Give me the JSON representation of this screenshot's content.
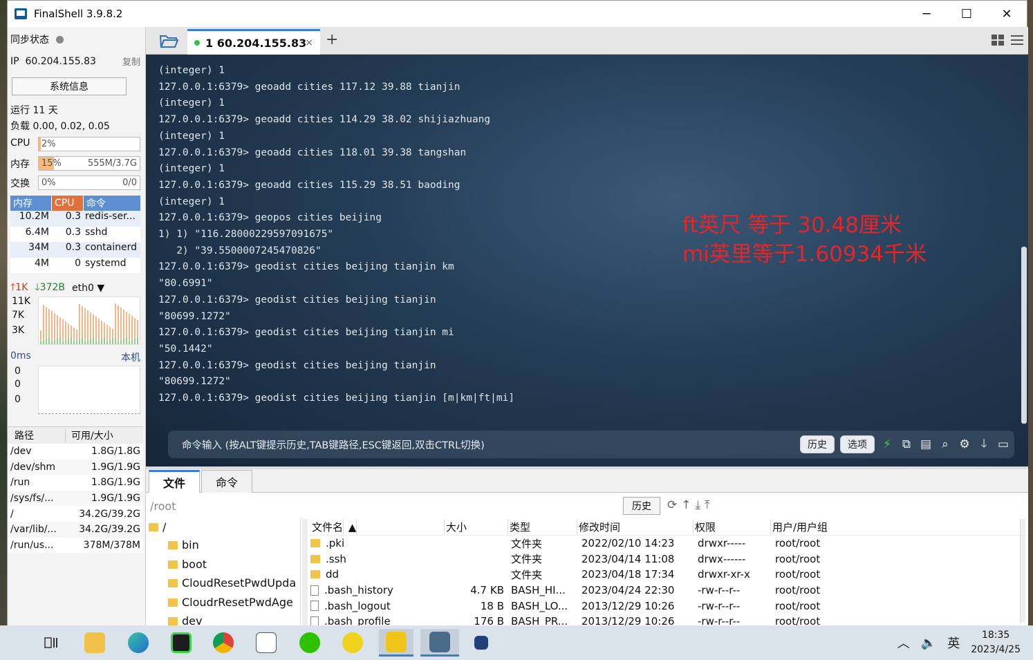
{
  "window": {
    "title": "FinalShell 3.9.8.2",
    "minimize": "─",
    "maximize": "☐",
    "close": "✕"
  },
  "left": {
    "sync_label": "同步状态",
    "ip_label": "IP",
    "ip_value": "60.204.155.83",
    "copy_label": "复制",
    "sysinfo_button": "系统信息",
    "uptime": "运行 11 天",
    "load": "负载 0.00, 0.02, 0.05",
    "cpu_label": "CPU",
    "cpu_value": "2%",
    "cpu_fraction": 0.02,
    "mem_label": "内存",
    "mem_value": "15%",
    "mem_fraction": 0.15,
    "mem_detail": "555M/3.7G",
    "swap_label": "交换",
    "swap_value": "0%",
    "swap_detail": "0/0",
    "proc_headers": [
      "内存",
      "CPU",
      "命令"
    ],
    "processes": [
      {
        "mem": "10.2M",
        "cpu": "0.3",
        "cmd": "redis-ser..."
      },
      {
        "mem": "6.4M",
        "cpu": "0.3",
        "cmd": "sshd"
      },
      {
        "mem": "34M",
        "cpu": "0.3",
        "cmd": "containerd"
      },
      {
        "mem": "4M",
        "cpu": "0",
        "cmd": "systemd"
      }
    ],
    "net_up": "1K",
    "net_down": "372B",
    "net_iface": "eth0",
    "net_axis": [
      "11K",
      "7K",
      "3K"
    ],
    "ping_ms": "0ms",
    "ping_target": "本机",
    "ping_axis": [
      "0",
      "0",
      "0"
    ],
    "disk_headers": [
      "路径",
      "可用/大小"
    ],
    "disks": [
      {
        "path": "/dev",
        "size": "1.8G/1.8G"
      },
      {
        "path": "/dev/shm",
        "size": "1.9G/1.9G"
      },
      {
        "path": "/run",
        "size": "1.8G/1.9G"
      },
      {
        "path": "/sys/fs/...",
        "size": "1.9G/1.9G"
      },
      {
        "path": "/",
        "size": "34.2G/39.2G"
      },
      {
        "path": "/var/lib/...",
        "size": "34.2G/39.2G"
      },
      {
        "path": "/run/us...",
        "size": "378M/378M"
      }
    ]
  },
  "tabs": {
    "session_label": "1 60.204.155.83",
    "close": "×",
    "add": "+"
  },
  "terminal": {
    "lines": [
      "(integer) 1",
      "127.0.0.1:6379> geoadd cities 117.12 39.88 tianjin",
      "(integer) 1",
      "127.0.0.1:6379> geoadd cities 114.29 38.02 shijiazhuang",
      "(integer) 1",
      "127.0.0.1:6379> geoadd cities 118.01 39.38 tangshan",
      "(integer) 1",
      "127.0.0.1:6379> geoadd cities 115.29 38.51 baoding",
      "(integer) 1",
      "127.0.0.1:6379> geopos cities beijing",
      "1) 1) \"116.28000229597091675\"",
      "   2) \"39.5500007245470826\"",
      "127.0.0.1:6379> geodist cities beijing tianjin km",
      "\"80.6991\"",
      "127.0.0.1:6379> geodist cities beijing tianjin",
      "\"80699.1272\"",
      "127.0.0.1:6379> geodist cities beijing tianjin mi",
      "\"50.1442\"",
      "127.0.0.1:6379> geodist cities beijing tianjin",
      "\"80699.1272\"",
      "127.0.0.1:6379> geodist cities beijing tianjin [m|km|ft|mi]"
    ],
    "annotation_1": "ft英尺 等于 30.48厘米",
    "annotation_2": "mi英里等于1.60934千米",
    "annotation_color": "#e4262a",
    "command_placeholder": "命令输入 (按ALT键提示历史,TAB键路径,ESC键返回,双击CTRL切换)",
    "history_button": "历史",
    "options_button": "选项"
  },
  "files": {
    "tab_files": "文件",
    "tab_commands": "命令",
    "path": "/root",
    "history_button": "历史",
    "tree": [
      {
        "name": "/",
        "level": 0
      },
      {
        "name": "bin",
        "level": 1
      },
      {
        "name": "boot",
        "level": 1
      },
      {
        "name": "CloudResetPwdUpda",
        "level": 1
      },
      {
        "name": "CloudrResetPwdAge",
        "level": 1
      },
      {
        "name": "dev",
        "level": 1
      }
    ],
    "headers": [
      "文件名",
      "大小",
      "类型",
      "修改时间",
      "权限",
      "用户/用户组"
    ],
    "rows": [
      {
        "name": ".pki",
        "size": "",
        "type": "文件夹",
        "date": "2022/02/10 14:23",
        "perm": "drwxr-----",
        "user": "root/root",
        "folder": true
      },
      {
        "name": ".ssh",
        "size": "",
        "type": "文件夹",
        "date": "2023/04/14 11:08",
        "perm": "drwx------",
        "user": "root/root",
        "folder": true
      },
      {
        "name": "dd",
        "size": "",
        "type": "文件夹",
        "date": "2023/04/18 17:34",
        "perm": "drwxr-xr-x",
        "user": "root/root",
        "folder": true
      },
      {
        "name": ".bash_history",
        "size": "4.7 KB",
        "type": "BASH_HI...",
        "date": "2023/04/24 22:30",
        "perm": "-rw-r--r--",
        "user": "root/root",
        "folder": false
      },
      {
        "name": ".bash_logout",
        "size": "18 B",
        "type": "BASH_LO...",
        "date": "2013/12/29 10:26",
        "perm": "-rw-r--r--",
        "user": "root/root",
        "folder": false
      },
      {
        "name": ".bash_profile",
        "size": "176 B",
        "type": "BASH_PR...",
        "date": "2013/12/29 10:26",
        "perm": "-rw-r--r--",
        "user": "root/root",
        "folder": false
      }
    ]
  },
  "taskbar": {
    "ime": "英",
    "time": "18:35",
    "date": "2023/4/25"
  }
}
